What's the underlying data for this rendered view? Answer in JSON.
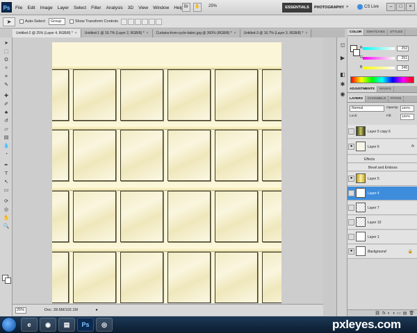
{
  "menubar": {
    "logo": "Ps",
    "menus": [
      "File",
      "Edit",
      "Image",
      "Layer",
      "Select",
      "Filter",
      "Analysis",
      "3D",
      "View",
      "Window",
      "Help"
    ],
    "zoom": "25%",
    "workspaces": {
      "active": "ESSENTIALS",
      "other": "PHOTOGRAPHY",
      "more": "»"
    },
    "cs_live": "CS Live",
    "window_controls": [
      "–",
      "□",
      "×"
    ]
  },
  "options": {
    "auto_select_label": "Auto-Select:",
    "auto_select_value": "Group",
    "show_transform_label": "Show Transform Controls"
  },
  "doc_tabs": [
    {
      "label": "Untitled-2 @ 25% (Layer 4, RGB/8) *",
      "active": true
    },
    {
      "label": "Untitled-1 @ 16.7% (Layer 2, RGB/8) *",
      "active": false
    },
    {
      "label": "Curtains-from-cycle-fabric.jpg @ 300% (RGB/8) *",
      "active": false
    },
    {
      "label": "Untitled-3 @ 16.7% (Layer 3, RGB/8) *",
      "active": false
    }
  ],
  "status": {
    "zoom": "25%",
    "doc": "Doc: 28.6M/102.1M",
    "arrow": "▸"
  },
  "color_panel": {
    "tabs": [
      "COLOR",
      "SWATCHES",
      "STYLES"
    ],
    "channels": [
      {
        "label": "R",
        "value": "252"
      },
      {
        "label": "G",
        "value": "251"
      },
      {
        "label": "B",
        "value": "246"
      }
    ]
  },
  "adjust_tabs": [
    "ADJUSTMENTS",
    "MASKS"
  ],
  "layers_panel": {
    "tabs": [
      "LAYERS",
      "CHANNELS",
      "PATHS"
    ],
    "blend_mode": "Normal",
    "opacity_label": "Opacity:",
    "opacity": "100%",
    "lock_label": "Lock:",
    "fill_label": "Fill:",
    "fill": "100%",
    "layers": [
      {
        "name": "Layer 5 copy 6",
        "visible": false,
        "selected": false
      },
      {
        "name": "Layer 6",
        "visible": true,
        "selected": false,
        "fx": "fx"
      },
      {
        "name": "Effects",
        "sub": true
      },
      {
        "name": "Bevel and Emboss",
        "sub": true
      },
      {
        "name": "Layer 5",
        "visible": true,
        "selected": false
      },
      {
        "name": "Layer 4",
        "visible": false,
        "selected": true
      },
      {
        "name": "Layer 7",
        "visible": false,
        "selected": false
      },
      {
        "name": "Layer 10",
        "visible": false,
        "selected": false
      },
      {
        "name": "Layer 1",
        "visible": false,
        "selected": false
      },
      {
        "name": "Background",
        "visible": true,
        "selected": false,
        "lock": "🔒"
      }
    ],
    "footer_icons": [
      "⛓",
      "fx",
      "◐",
      "◑",
      "▭",
      "▤",
      "🗑"
    ]
  },
  "taskbar": {
    "apps": [
      "e",
      "◉",
      "▤",
      "Ps",
      "◎"
    ]
  },
  "watermark": "pxleyes.com"
}
